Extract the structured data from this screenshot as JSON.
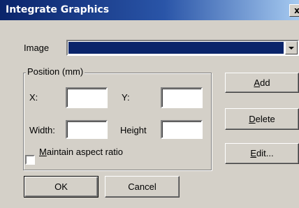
{
  "window": {
    "title": "Integrate Graphics",
    "close_label": "x"
  },
  "image": {
    "label": "Image",
    "selected_value": ""
  },
  "position": {
    "group_label": "Position (mm)",
    "x_label": "X:",
    "x_value": "",
    "y_label": "Y:",
    "y_value": "",
    "width_label": "Width:",
    "width_value": "",
    "height_label": "Height",
    "height_value": "",
    "aspect": {
      "label_mnemonic": "M",
      "label_rest": "aintain aspect ratio",
      "checked": false
    }
  },
  "buttons": {
    "add": {
      "mnemonic": "A",
      "rest": "dd"
    },
    "delete": {
      "mnemonic": "D",
      "rest": "elete"
    },
    "edit": {
      "mnemonic": "E",
      "rest": "dit..."
    },
    "ok": "OK",
    "cancel": "Cancel"
  },
  "colors": {
    "title_start": "#0a246a",
    "title_end": "#a6caf0",
    "face": "#d4d0c8",
    "selection": "#0a246a"
  }
}
